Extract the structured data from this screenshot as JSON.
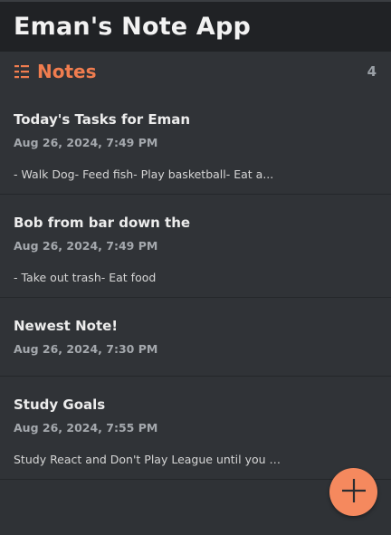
{
  "app": {
    "title": "Eman's Note App"
  },
  "section": {
    "icon": "list-icon",
    "title": "Notes",
    "count": "4"
  },
  "notes": [
    {
      "title": "Today's Tasks for Eman",
      "date": "Aug 26, 2024, 7:49 PM",
      "preview": "- Walk Dog- Feed fish- Play basketball- Eat a..."
    },
    {
      "title": "Bob from bar down the",
      "date": "Aug 26, 2024, 7:49 PM",
      "preview": "- Take out trash- Eat food"
    },
    {
      "title": "Newest Note!",
      "date": "Aug 26, 2024, 7:30 PM",
      "preview": ""
    },
    {
      "title": "Study Goals",
      "date": "Aug 26, 2024, 7:55 PM",
      "preview": "Study React and Don't Play League until you d..."
    }
  ],
  "fab": {
    "icon": "plus-icon"
  },
  "colors": {
    "accent": "#f07d4f",
    "fab": "#f5895e",
    "background": "#2f3236",
    "header": "#202225"
  }
}
